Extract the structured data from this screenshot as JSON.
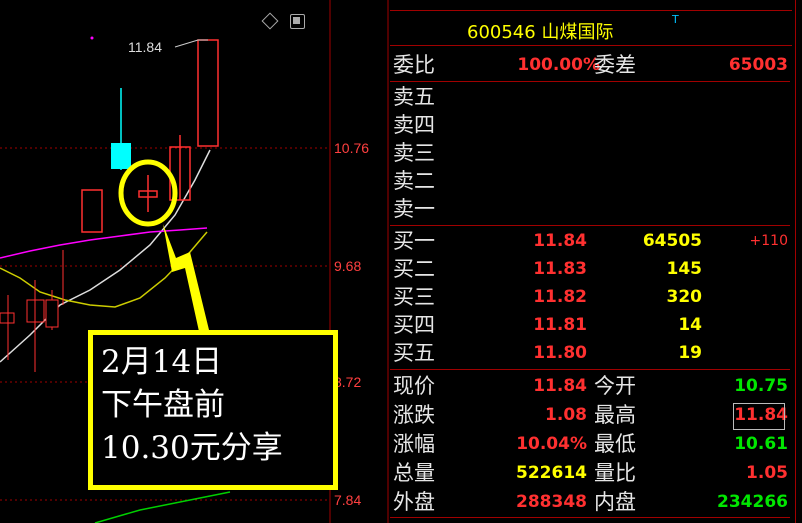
{
  "chart": {
    "price_ticks": [
      "10.76",
      "9.68",
      "8.72",
      "7.84"
    ],
    "high_label": "11.84",
    "annotation": {
      "line1": "2月14日",
      "line2": "下午盘前",
      "line3": "10.30元分享"
    },
    "colors": {
      "up": "#ff3030",
      "down": "#00ffff",
      "ma_magenta": "#ff00ff",
      "ma_yellow": "#cccc00",
      "ma_white": "#dddddd",
      "ma_green": "#00d000",
      "annotation": "#ffff00"
    },
    "toolbar_icons": [
      "diamond-icon",
      "window-icon"
    ]
  },
  "quote": {
    "code": "600546",
    "name": "山煤国际",
    "badge": "T",
    "weibi_label": "委比",
    "weibi_value": "100.00%",
    "weicha_label": "委差",
    "weicha_value": "65003",
    "asks": [
      {
        "label": "卖五",
        "price": "",
        "volume": ""
      },
      {
        "label": "卖四",
        "price": "",
        "volume": ""
      },
      {
        "label": "卖三",
        "price": "",
        "volume": ""
      },
      {
        "label": "卖二",
        "price": "",
        "volume": ""
      },
      {
        "label": "卖一",
        "price": "",
        "volume": ""
      }
    ],
    "bids": [
      {
        "label": "买一",
        "price": "11.84",
        "volume": "64505",
        "change": "+110"
      },
      {
        "label": "买二",
        "price": "11.83",
        "volume": "145",
        "change": ""
      },
      {
        "label": "买三",
        "price": "11.82",
        "volume": "320",
        "change": ""
      },
      {
        "label": "买四",
        "price": "11.81",
        "volume": "14",
        "change": ""
      },
      {
        "label": "买五",
        "price": "11.80",
        "volume": "19",
        "change": ""
      }
    ],
    "stats": [
      {
        "l1": "现价",
        "v1": "11.84",
        "l2": "今开",
        "v2": "10.75"
      },
      {
        "l1": "涨跌",
        "v1": "1.08",
        "l2": "最高",
        "v2": "11.84"
      },
      {
        "l1": "涨幅",
        "v1": "10.04%",
        "l2": "最低",
        "v2": "10.61"
      },
      {
        "l1": "总量",
        "v1": "522614",
        "l2": "量比",
        "v2": "1.05"
      },
      {
        "l1": "外盘",
        "v1": "288348",
        "l2": "内盘",
        "v2": "234266"
      }
    ]
  }
}
